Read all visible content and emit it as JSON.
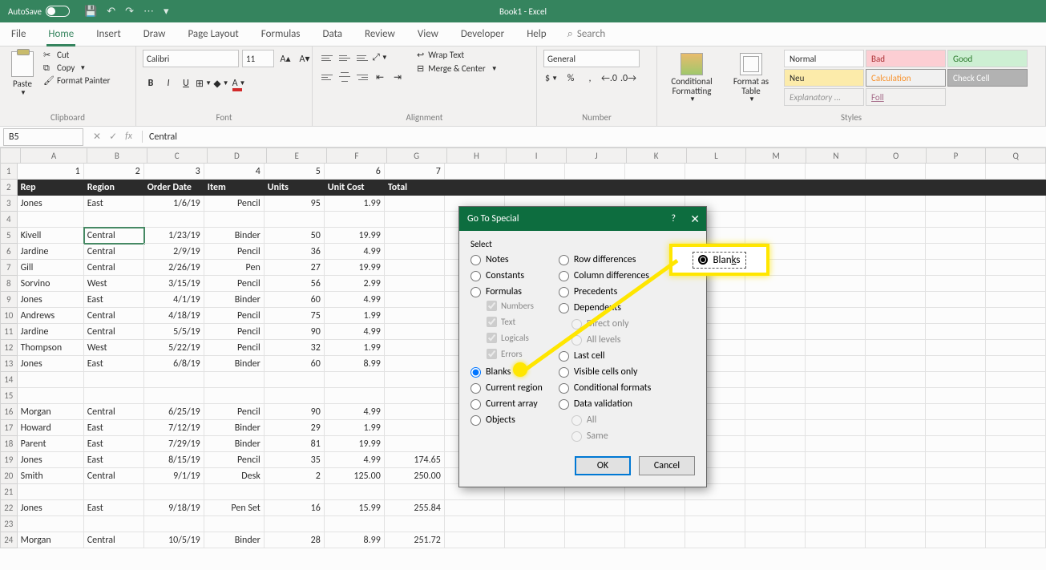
{
  "titlebar": {
    "autosave": "AutoSave",
    "toggle": "Off",
    "document": "Book1 - Excel"
  },
  "tabs": [
    "File",
    "Home",
    "Insert",
    "Draw",
    "Page Layout",
    "Formulas",
    "Data",
    "Review",
    "View",
    "Developer",
    "Help"
  ],
  "search_label": "Search",
  "ribbon": {
    "clipboard": {
      "paste": "Paste",
      "cut": "Cut",
      "copy": "Copy",
      "fp": "Format Painter",
      "label": "Clipboard"
    },
    "font": {
      "name": "Calibri",
      "size": "11",
      "label": "Font"
    },
    "alignment": {
      "wrap": "Wrap Text",
      "merge": "Merge & Center",
      "label": "Alignment"
    },
    "number": {
      "format": "General",
      "label": "Number"
    },
    "styles": {
      "cond": "Conditional Formatting",
      "fat": "Format as Table",
      "cells": [
        "Normal",
        "Bad",
        "Good",
        "Neu",
        "Calculation",
        "Check Cell",
        "Explanatory ...",
        "Foll"
      ],
      "label": "Styles"
    }
  },
  "formula_bar": {
    "name_box": "B5",
    "formula": "Central"
  },
  "columns": [
    "A",
    "B",
    "C",
    "D",
    "E",
    "F",
    "G",
    "H",
    "I",
    "J",
    "K",
    "L",
    "M",
    "N",
    "O",
    "P",
    "Q"
  ],
  "chart_data": {
    "type": "table",
    "row1": [
      "1",
      "2",
      "3",
      "4",
      "5",
      "6",
      "7"
    ],
    "headers": [
      "Rep",
      "Region",
      "Order Date",
      "Item",
      "Units",
      "Unit Cost",
      "Total"
    ],
    "rows": [
      [
        "Jones",
        "East",
        "1/6/19",
        "Pencil",
        "95",
        "1.99",
        ""
      ],
      [
        "",
        "",
        "",
        "",
        "",
        "",
        ""
      ],
      [
        "Kivell",
        "Central",
        "1/23/19",
        "Binder",
        "50",
        "19.99",
        ""
      ],
      [
        "Jardine",
        "Central",
        "2/9/19",
        "Pencil",
        "36",
        "4.99",
        ""
      ],
      [
        "Gill",
        "Central",
        "2/26/19",
        "Pen",
        "27",
        "19.99",
        ""
      ],
      [
        "Sorvino",
        "West",
        "3/15/19",
        "Pencil",
        "56",
        "2.99",
        ""
      ],
      [
        "Jones",
        "East",
        "4/1/19",
        "Binder",
        "60",
        "4.99",
        ""
      ],
      [
        "Andrews",
        "Central",
        "4/18/19",
        "Pencil",
        "75",
        "1.99",
        ""
      ],
      [
        "Jardine",
        "Central",
        "5/5/19",
        "Pencil",
        "90",
        "4.99",
        ""
      ],
      [
        "Thompson",
        "West",
        "5/22/19",
        "Pencil",
        "32",
        "1.99",
        ""
      ],
      [
        "Jones",
        "East",
        "6/8/19",
        "Binder",
        "60",
        "8.99",
        ""
      ],
      [
        "",
        "",
        "",
        "",
        "",
        "",
        ""
      ],
      [
        "",
        "",
        "",
        "",
        "",
        "",
        ""
      ],
      [
        "Morgan",
        "Central",
        "6/25/19",
        "Pencil",
        "90",
        "4.99",
        ""
      ],
      [
        "Howard",
        "East",
        "7/12/19",
        "Binder",
        "29",
        "1.99",
        ""
      ],
      [
        "Parent",
        "East",
        "7/29/19",
        "Binder",
        "81",
        "19.99",
        ""
      ],
      [
        "Jones",
        "East",
        "8/15/19",
        "Pencil",
        "35",
        "4.99",
        "174.65"
      ],
      [
        "Smith",
        "Central",
        "9/1/19",
        "Desk",
        "2",
        "125.00",
        "250.00"
      ],
      [
        "",
        "",
        "",
        "",
        "",
        "",
        ""
      ],
      [
        "Jones",
        "East",
        "9/18/19",
        "Pen Set",
        "16",
        "15.99",
        "255.84"
      ],
      [
        "",
        "",
        "",
        "",
        "",
        "",
        ""
      ],
      [
        "Morgan",
        "Central",
        "10/5/19",
        "Binder",
        "28",
        "8.99",
        "251.72"
      ]
    ]
  },
  "dialog": {
    "title": "Go To Special",
    "select": "Select",
    "left": [
      "Notes",
      "Constants",
      "Formulas"
    ],
    "left_sub": [
      "Numbers",
      "Text",
      "Logicals",
      "Errors"
    ],
    "left2": [
      "Blanks",
      "Current region",
      "Current array",
      "Objects"
    ],
    "right": [
      "Row differences",
      "Column differences",
      "Precedents",
      "Dependents"
    ],
    "right_sub": [
      "Direct only",
      "All levels"
    ],
    "right2": [
      "Last cell",
      "Visible cells only",
      "Conditional formats",
      "Data validation"
    ],
    "right_sub2": [
      "All",
      "Same"
    ],
    "ok": "OK",
    "cancel": "Cancel"
  },
  "callout": {
    "label": "Blanks",
    "u": "k"
  }
}
